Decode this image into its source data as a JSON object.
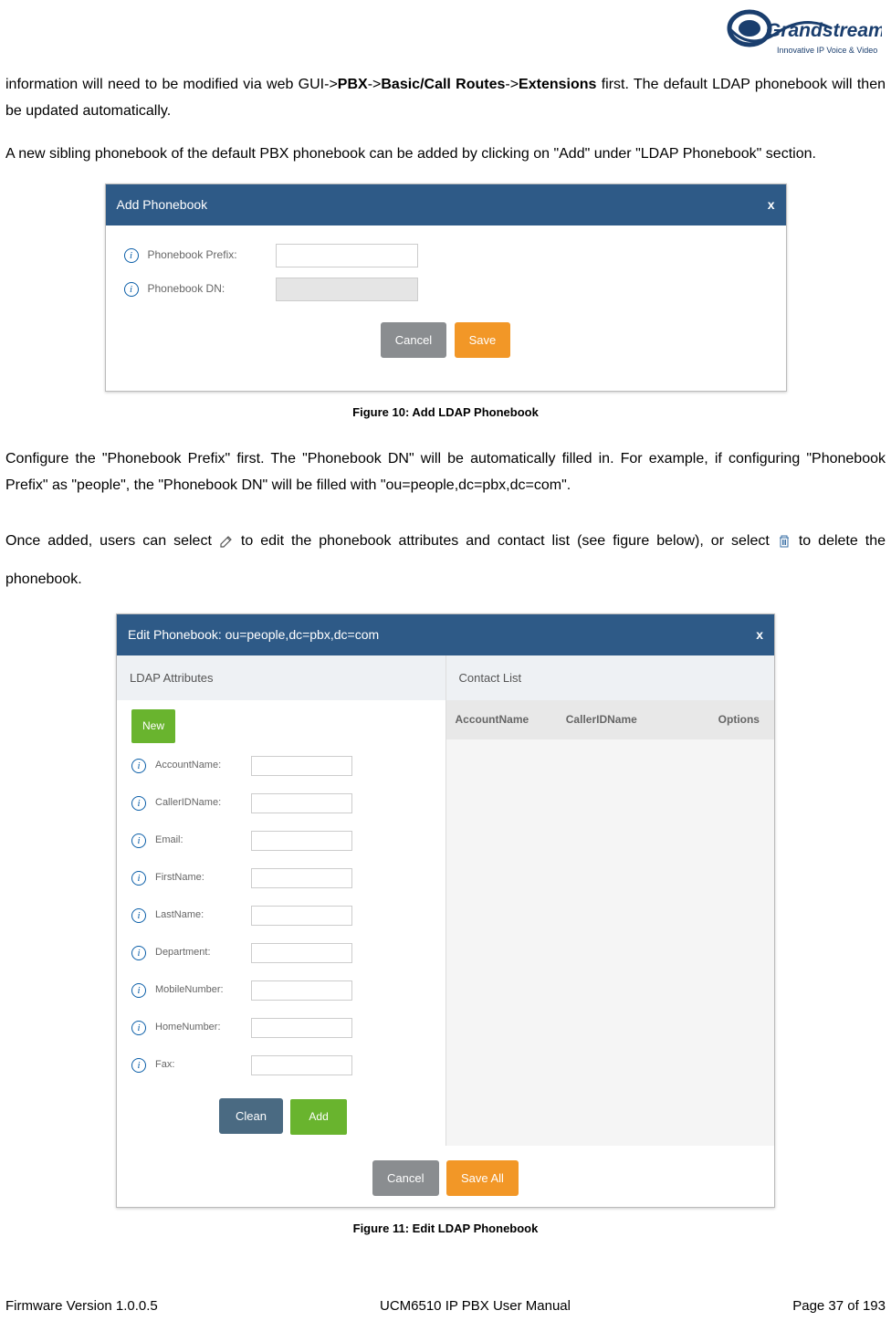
{
  "logo": {
    "brand": "Grandstream",
    "tag": "Innovative IP Voice & Video"
  },
  "para1": {
    "pre": "information will need to be modified via web GUI->",
    "b1": "PBX",
    "s1": "->",
    "b2": "Basic/Call Routes",
    "s2": "->",
    "b3": "Extensions",
    "post": " first. The default LDAP phonebook will then be updated automatically."
  },
  "para2": "A new sibling phonebook of the default PBX phonebook can be added by clicking on \"Add\" under \"LDAP Phonebook\" section.",
  "fig10": {
    "title": "Add Phonebook",
    "fields": [
      {
        "label": "Phonebook Prefix:",
        "disabled": false
      },
      {
        "label": "Phonebook DN:",
        "disabled": true
      }
    ],
    "cancel": "Cancel",
    "save": "Save",
    "caption": "Figure 10: Add LDAP Phonebook"
  },
  "para3": "Configure the \"Phonebook Prefix\" first. The \"Phonebook DN\" will be automatically filled in. For example, if configuring \"Phonebook Prefix\" as \"people\", the \"Phonebook DN\" will be filled with \"ou=people,dc=pbx,dc=com\".",
  "para4": {
    "pre": "Once added, users can select ",
    "mid": " to edit the phonebook attributes and contact list (see figure below), or select ",
    "post": " to delete the phonebook."
  },
  "fig11": {
    "title": "Edit Phonebook: ou=people,dc=pbx,dc=com",
    "attr_hdr": "LDAP Attributes",
    "cl_hdr": "Contact List",
    "cl_cols": [
      "AccountName",
      "CallerIDName",
      "Options"
    ],
    "new": "New",
    "attrs": [
      "AccountName:",
      "CallerIDName:",
      "Email:",
      "FirstName:",
      "LastName:",
      "Department:",
      "MobileNumber:",
      "HomeNumber:",
      "Fax:"
    ],
    "clean": "Clean",
    "add": "Add",
    "cancel": "Cancel",
    "saveall": "Save All",
    "caption": "Figure 11: Edit LDAP Phonebook"
  },
  "footer": {
    "left": "Firmware Version 1.0.0.5",
    "center": "UCM6510 IP PBX User Manual",
    "right": "Page 37 of 193"
  }
}
